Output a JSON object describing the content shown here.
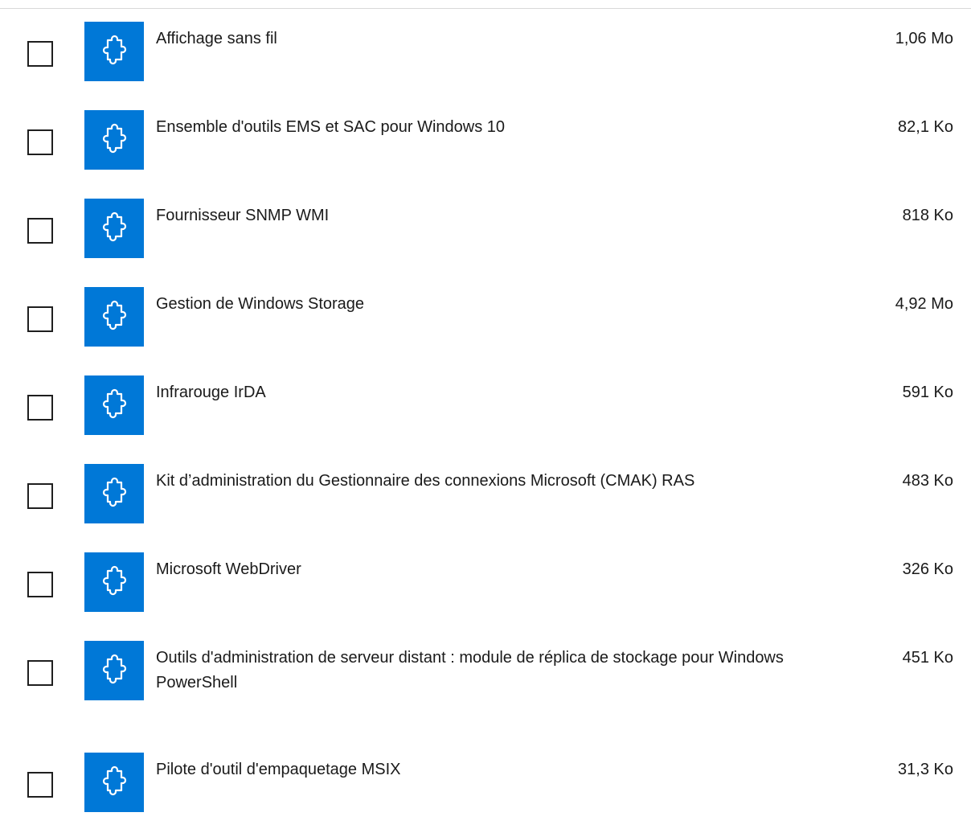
{
  "features": [
    {
      "name": "Affichage sans fil",
      "size": "1,06 Mo"
    },
    {
      "name": "Ensemble d'outils EMS et SAC pour Windows 10",
      "size": "82,1 Ko"
    },
    {
      "name": "Fournisseur SNMP WMI",
      "size": "818 Ko"
    },
    {
      "name": "Gestion de Windows Storage",
      "size": "4,92 Mo"
    },
    {
      "name": "Infrarouge IrDA",
      "size": "591 Ko"
    },
    {
      "name": "Kit d’administration du Gestionnaire des connexions Microsoft (CMAK) RAS",
      "size": "483 Ko"
    },
    {
      "name": "Microsoft WebDriver",
      "size": "326 Ko"
    },
    {
      "name": "Outils d'administration de serveur distant : module de réplica de stockage pour Windows PowerShell",
      "size": "451 Ko"
    },
    {
      "name": "Pilote d'outil d'empaquetage MSIX",
      "size": "31,3 Ko"
    }
  ],
  "icon": "puzzle-piece-icon",
  "colors": {
    "tile": "#0078d7",
    "text": "#1a1a1a"
  }
}
